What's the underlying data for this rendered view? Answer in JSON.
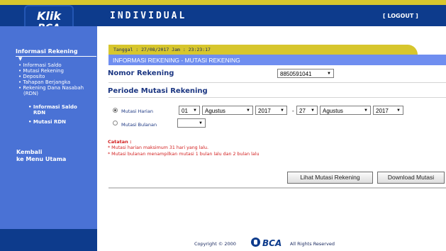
{
  "header": {
    "logo_top": "Klik",
    "logo_bottom": "BCA",
    "title": "INDIVIDUAL",
    "logout_label": "[ LOGOUT ]"
  },
  "sidebar": {
    "heading": "Informasi Rekening",
    "items": [
      {
        "label": "Informasi Saldo"
      },
      {
        "label": "Mutasi Rekening"
      },
      {
        "label": "Deposito"
      },
      {
        "label": "Tahapan Berjangka"
      },
      {
        "label": "Rekening Dana Nasabah"
      },
      {
        "label": "(RDN)"
      },
      {
        "label": "Informasi Saldo"
      },
      {
        "label": "RDN"
      },
      {
        "label": "Mutasi RDN"
      }
    ],
    "back_line1": "Kembali",
    "back_line2": "ke Menu Utama"
  },
  "main": {
    "date_text": "Tanggal : 27/08/2017 Jam : 23:23:17",
    "page_title": "INFORMASI REKENING - MUTASI REKENING",
    "nomor_label": "Nomor Rekening",
    "account_number": "8850591041",
    "periode_label": "Periode Mutasi Rekening",
    "harian_label": "Mutasi Harian",
    "bulanan_label": "Mutasi Bulanan",
    "start": {
      "day": "01",
      "month": "Agustus",
      "year": "2017"
    },
    "dash": "-",
    "end": {
      "day": "27",
      "month": "Agustus",
      "year": "2017"
    },
    "bulanan_value": "",
    "notes_title": "Catatan :",
    "notes": [
      "* Mutasi harian maksimum 31 hari yang lalu.",
      "* Mutasi bulanan menampilkan mutasi 1 bulan lalu dan 2 bulan lalu"
    ],
    "view_button": "Lihat Mutasi Rekening",
    "download_button": "Download Mutasi"
  },
  "footer": {
    "copyright": "Copyright © 2000",
    "brand": "BCA",
    "rights": "All Rights Reserved"
  },
  "colors": {
    "header_blue": "#0d3b8c",
    "sidebar_blue": "#4a72d5",
    "accent_yellow": "#d7c62d",
    "title_bar": "#6f8ef0",
    "note_red": "#d21e1e"
  }
}
